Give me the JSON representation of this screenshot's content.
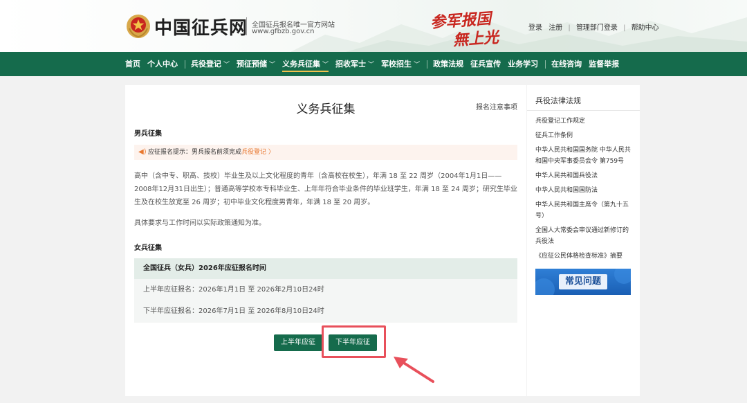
{
  "header": {
    "site_name": "中国征兵网",
    "subtitle": "全国征兵报名唯一官方网站",
    "url": "www.gfbzb.gov.cn",
    "slogan_line1": "参军报国",
    "slogan_line2": "無上光榮",
    "links": [
      "登录",
      "注册",
      "管理部门登录",
      "帮助中心"
    ]
  },
  "nav": {
    "items": [
      {
        "label": "首页",
        "caret": false
      },
      {
        "label": "个人中心",
        "caret": false
      },
      {
        "label": "兵役登记",
        "caret": true
      },
      {
        "label": "预征预储",
        "caret": true
      },
      {
        "label": "义务兵征集",
        "caret": true,
        "active": true
      },
      {
        "label": "招收军士",
        "caret": true
      },
      {
        "label": "军校招生",
        "caret": true
      },
      {
        "label": "政策法规",
        "caret": false
      },
      {
        "label": "征兵宣传",
        "caret": false
      },
      {
        "label": "业务学习",
        "caret": false
      },
      {
        "label": "在线咨询",
        "caret": false
      },
      {
        "label": "监督举报",
        "caret": false
      }
    ]
  },
  "main": {
    "title": "义务兵征集",
    "notice_link": "报名注意事项",
    "male_title": "男兵征集",
    "tip_prefix": "应征报名提示：男兵报名前须完成",
    "tip_link": "兵役登记 〉",
    "male_paragraph": "高中（含中专、职高、技校）毕业生及以上文化程度的青年（含高校在校生），年满 18 至 22 周岁（2004年1月1日——2008年12月31日出生）；普通高等学校本专科毕业生、上年年符合毕业条件的毕业班学生，年满 18 至 24 周岁；研究生毕业生及在校生放宽至 26 周岁；初中毕业文化程度男青年，年满 18 至 20 周岁。",
    "policy_note": "具体要求与工作时间以实际政策通知为准。",
    "female_title": "女兵征集",
    "female_table": {
      "header": "全国征兵（女兵）2026年应征报名时间",
      "rows": [
        "上半年应征报名：2026年1月1日 至 2026年2月10日24时",
        "下半年应征报名：2026年7月1日 至 2026年8月10日24时"
      ]
    },
    "btn_first_half": "上半年应征",
    "btn_second_half": "下半年应征"
  },
  "sidebar": {
    "title": "兵役法律法规",
    "items": [
      "兵役登记工作规定",
      "征兵工作条例",
      "中华人民共和国国务院 中华人民共和国中央军事委员会令 第759号",
      "中华人民共和国兵役法",
      "中华人民共和国国防法",
      "中华人民共和国主席令（第九十五号）",
      "全国人大常委会审议通过新修订的兵役法",
      "《应征公民体格检查标准》摘要"
    ],
    "faq_label": "常见问题"
  },
  "colors": {
    "brand_green": "#156b4c",
    "highlight": "#e8505b",
    "accent_orange": "#e8772e"
  }
}
